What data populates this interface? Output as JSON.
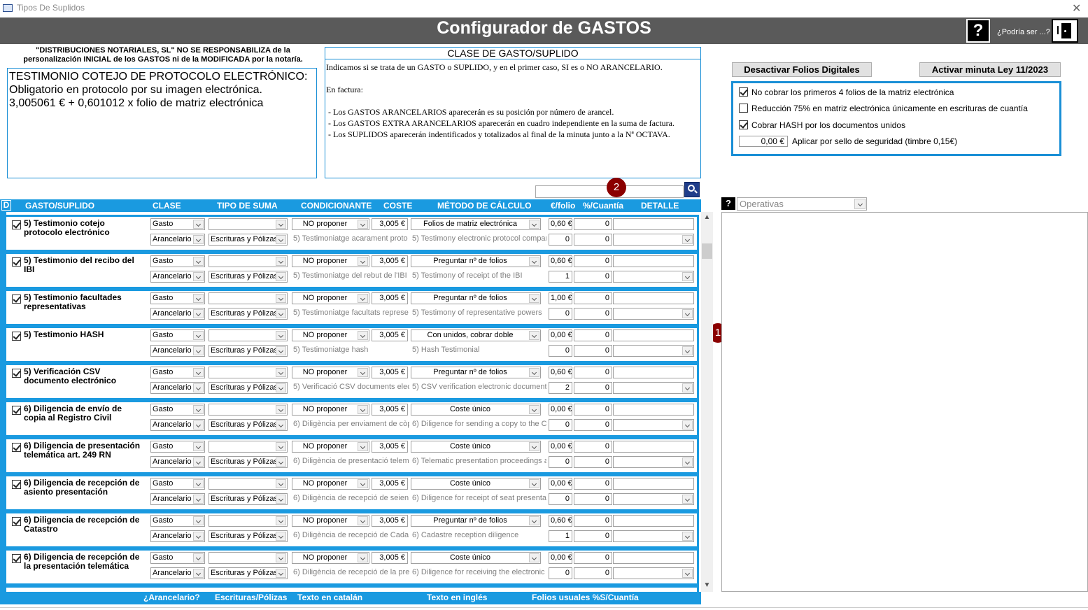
{
  "window": {
    "title": "Tipos De Suplidos"
  },
  "header": {
    "title": "Configurador de GASTOS",
    "help_label": "?",
    "could_be_label": "¿Podría ser ...?"
  },
  "disclaimer": "\"DISTRIBUCIONES NOTARIALES, SL\" NO SE RESPONSABILIZA de la personalización INICIAL de los GASTOS ni de la MODIFICADA por la notaría.",
  "description": "TESTIMONIO COTEJO DE PROTOCOLO ELECTRÓNICO:\nObligatorio en protocolo por su imagen electrónica.\n3,005061 € + 0,601012 x folio de matriz electrónica",
  "clase_panel": {
    "title": "CLASE DE GASTO/SUPLIDO",
    "text": "Indicamos si se trata de un GASTO o SUPLIDO, y en el primer caso, SI es o NO ARANCELARIO.\n\nEn factura:\n\n - Los GASTOS ARANCELARIOS aparecerán es su posición por número de arancel.\n - Los GASTOS EXTRA ARANCELARIOS aparecerán en cuadro independiente en la suma de factura.\n - Los SUPLIDOS aparecerán indentificados y totalizados al final de la minuta junto a la Nª OCTAVA."
  },
  "buttons": {
    "deactivate_folios": "Desactivar Folios Digitales",
    "activate_minuta": "Activar minuta Ley 11/2023"
  },
  "options": {
    "opt1": "No cobrar los primeros 4 folios de la matriz electrónica",
    "opt2": "Reducción 75% en matriz electrónica únicamente en escrituras de cuantía",
    "opt3": "Cobrar HASH por los documentos unidos",
    "seal_value": "0,00 €",
    "seal_label": "Aplicar por sello de seguridad (timbre  0,15€)"
  },
  "badges": {
    "one": "1",
    "two": "2"
  },
  "columns": {
    "d": "D",
    "gasto": "GASTO/SUPLIDO",
    "clase": "CLASE",
    "tipo": "TIPO DE SUMA",
    "cond": "CONDICIONANTE",
    "coste": "COSTE",
    "metodo": "MÉTODO DE CÁLCULO",
    "folio": "€/folio",
    "cuantia": "%/Cuantía",
    "detalle": "DETALLE"
  },
  "footer": {
    "arancelario": "¿Arancelario?",
    "escrituras": "Escrituras/Pólizas",
    "catalan": "Texto en catalán",
    "ingles": "Texto en inglés",
    "folios": "Folios usuales %S/Cuantía"
  },
  "right_panel": {
    "help": "?",
    "select_value": "Operativas"
  },
  "rows": [
    {
      "name": "5) Testimonio cotejo protocolo electrónico",
      "clase": "Gasto",
      "arancel": "Arancelario",
      "tipo": "",
      "tipo2": "Escrituras y Pólizas",
      "cond": "NO proponer",
      "coste": "3,005 €",
      "ca": "5) Testimoniatge acarament proto",
      "metodo": "Folios de matriz electrónica",
      "en": "5) Testimony electronic protocol compari",
      "folio": "0,60 €",
      "folios": "0",
      "pct": "0",
      "pct2": "0"
    },
    {
      "name": "5) Testimonio del recibo del IBI",
      "clase": "Gasto",
      "arancel": "Arancelario",
      "tipo": "",
      "tipo2": "Escrituras y Pólizas",
      "cond": "NO proponer",
      "coste": "3,005 €",
      "ca": "5) Testimoniatge del rebut de l'IBI",
      "metodo": "Preguntar nº de folios",
      "en": "5) Testimony of receipt of the IBI",
      "folio": "0,60 €",
      "folios": "1",
      "pct": "0",
      "pct2": "0"
    },
    {
      "name": "5) Testimonio facultades representativas",
      "clase": "Gasto",
      "arancel": "Arancelario",
      "tipo": "",
      "tipo2": "Escrituras y Pólizas",
      "cond": "NO proponer",
      "coste": "3,005 €",
      "ca": "5) Testimoniatge facultats represe",
      "metodo": "Preguntar nº de folios",
      "en": "5) Testimony of representative powers",
      "folio": "1,00 €",
      "folios": "0",
      "pct": "0",
      "pct2": "0"
    },
    {
      "name": "5) Testimonio HASH",
      "clase": "Gasto",
      "arancel": "Arancelario",
      "tipo": "",
      "tipo2": "Escrituras y Pólizas",
      "cond": "NO proponer",
      "coste": "3,005 €",
      "ca": "5) Testimoniatge hash",
      "metodo": "Con unidos, cobrar doble",
      "en": "5) Hash Testimonial",
      "folio": "0,00 €",
      "folios": "0",
      "pct": "0",
      "pct2": "0"
    },
    {
      "name": "5) Verificación CSV documento electrónico",
      "clase": "Gasto",
      "arancel": "Arancelario",
      "tipo": "",
      "tipo2": "Escrituras y Pólizas",
      "cond": "NO proponer",
      "coste": "3,005 €",
      "ca": "5) Verificació CSV documents elec",
      "metodo": "Preguntar nº de folios",
      "en": "5) CSV verification electronic documents",
      "folio": "0,60 €",
      "folios": "2",
      "pct": "0",
      "pct2": "0"
    },
    {
      "name": "6) Diligencia de envío de copia al Registro Civil",
      "clase": "Gasto",
      "arancel": "Arancelario",
      "tipo": "",
      "tipo2": "Escrituras y Pólizas",
      "cond": "NO proponer",
      "coste": "3,005 €",
      "ca": "6) Diligència per enviament de còp",
      "metodo": "Coste único",
      "en": "6) Diligence for sending a copy to the Civ",
      "folio": "0,00 €",
      "folios": "0",
      "pct": "0",
      "pct2": "0"
    },
    {
      "name": "6) Diligencia de presentación telemática art. 249 RN",
      "clase": "Gasto",
      "arancel": "Arancelario",
      "tipo": "",
      "tipo2": "Escrituras y Pólizas",
      "cond": "NO proponer",
      "coste": "3,005 €",
      "ca": "6) Diligència de presentació telem",
      "metodo": "Coste único",
      "en": "6) Telematic presentation proceedings ar",
      "folio": "0,00 €",
      "folios": "0",
      "pct": "0",
      "pct2": "0"
    },
    {
      "name": "6) Diligencia de recepción de asiento presentación",
      "clase": "Gasto",
      "arancel": "Arancelario",
      "tipo": "",
      "tipo2": "Escrituras y Pólizas",
      "cond": "NO proponer",
      "coste": "3,005 €",
      "ca": "6) Diligència de recepció de seien",
      "metodo": "Coste único",
      "en": "6) Diligence for receipt of seat presentati",
      "folio": "0,00 €",
      "folios": "0",
      "pct": "0",
      "pct2": "0"
    },
    {
      "name": "6) Diligencia de recepción de Catastro",
      "clase": "Gasto",
      "arancel": "Arancelario",
      "tipo": "",
      "tipo2": "Escrituras y Pólizas",
      "cond": "NO proponer",
      "coste": "3,005 €",
      "ca": "6) Diligència de recepció de Cada",
      "metodo": "Preguntar nº de folios",
      "en": "6) Cadastre reception diligence",
      "folio": "0,60 €",
      "folios": "1",
      "pct": "0",
      "pct2": "0"
    },
    {
      "name": "6) Diligencia de recepción de la presentación telemática",
      "clase": "Gasto",
      "arancel": "Arancelario",
      "tipo": "",
      "tipo2": "Escrituras y Pólizas",
      "cond": "NO proponer",
      "coste": "3,005 €",
      "ca": "6) Diligència de recepció de la pre",
      "metodo": "Coste único",
      "en": "6) Diligence for receiving the electronic p",
      "folio": "0,00 €",
      "folios": "0",
      "pct": "0",
      "pct2": "0"
    }
  ]
}
